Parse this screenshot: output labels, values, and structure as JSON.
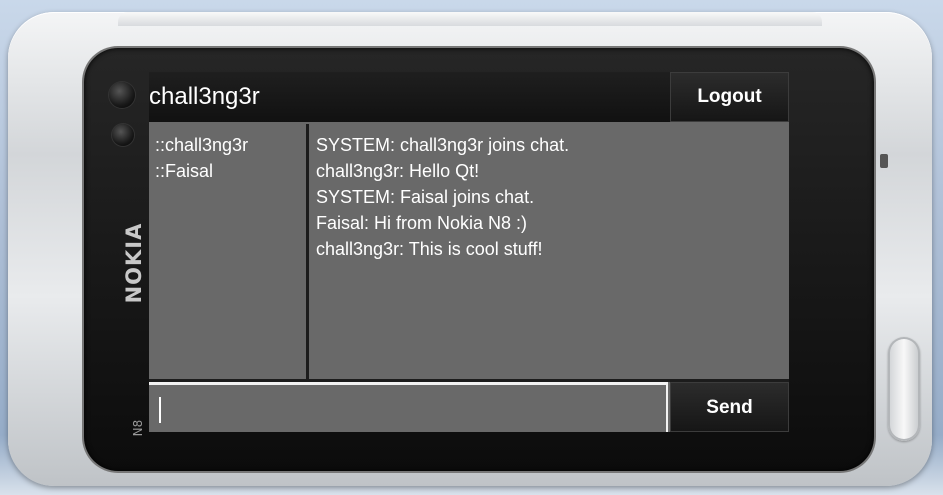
{
  "device": {
    "brand": "NOKIA",
    "model": "N8"
  },
  "header": {
    "username": "chall3ng3r",
    "logout_label": "Logout"
  },
  "users": [
    "::chall3ng3r",
    "::Faisal"
  ],
  "messages": [
    "SYSTEM: chall3ng3r joins chat.",
    "chall3ng3r: Hello Qt!",
    "SYSTEM: Faisal joins chat.",
    "Faisal: Hi from Nokia N8 :)",
    "chall3ng3r: This is cool stuff!"
  ],
  "composer": {
    "value": "",
    "send_label": "Send"
  },
  "colors": {
    "panel_gray": "#696969",
    "header_black": "#111111",
    "text_white": "#ffffff"
  }
}
